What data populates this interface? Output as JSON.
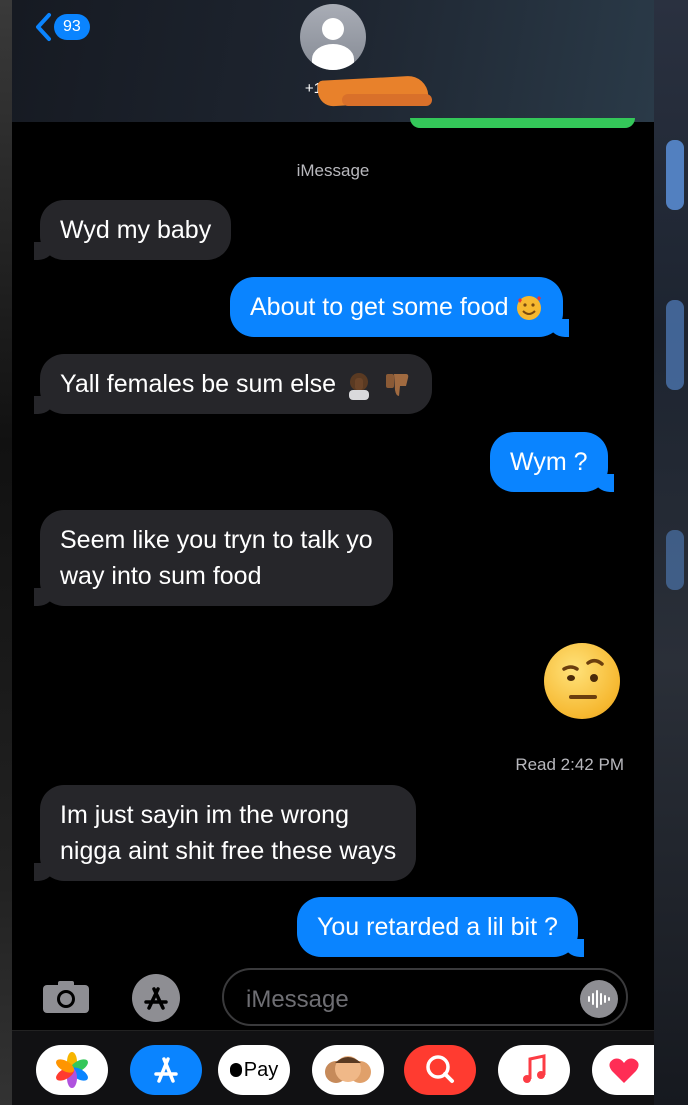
{
  "header": {
    "back_badge": "93",
    "contact": "+1 (414)"
  },
  "thread": {
    "service_label": "iMessage",
    "messages": [
      {
        "dir": "in",
        "text": "Wyd my baby"
      },
      {
        "dir": "out",
        "text": "About to get some food",
        "emoji": "smiling-face-with-hearts"
      },
      {
        "dir": "in",
        "text": "Yall females be sum else",
        "emoji": "facepalm, thumbs-down"
      },
      {
        "dir": "out",
        "text": "Wym ?"
      },
      {
        "dir": "in",
        "line1": "Seem like you tryn to talk yo",
        "line2": "way into sum food"
      },
      {
        "dir": "out",
        "emoji": "face-with-raised-eyebrow"
      },
      {
        "dir": "in",
        "line1": "Im just sayin im the wrong",
        "line2": "nigga aint shit free these ways"
      },
      {
        "dir": "out",
        "text": "You retarded a lil bit ?"
      }
    ],
    "read_receipt": "Read 2:42 PM"
  },
  "input": {
    "placeholder": "iMessage"
  },
  "drawer": {
    "apple_pay": "Pay"
  },
  "colors": {
    "incoming": "#26262a",
    "outgoing": "#0a84ff",
    "redaction": "#e8812b"
  }
}
